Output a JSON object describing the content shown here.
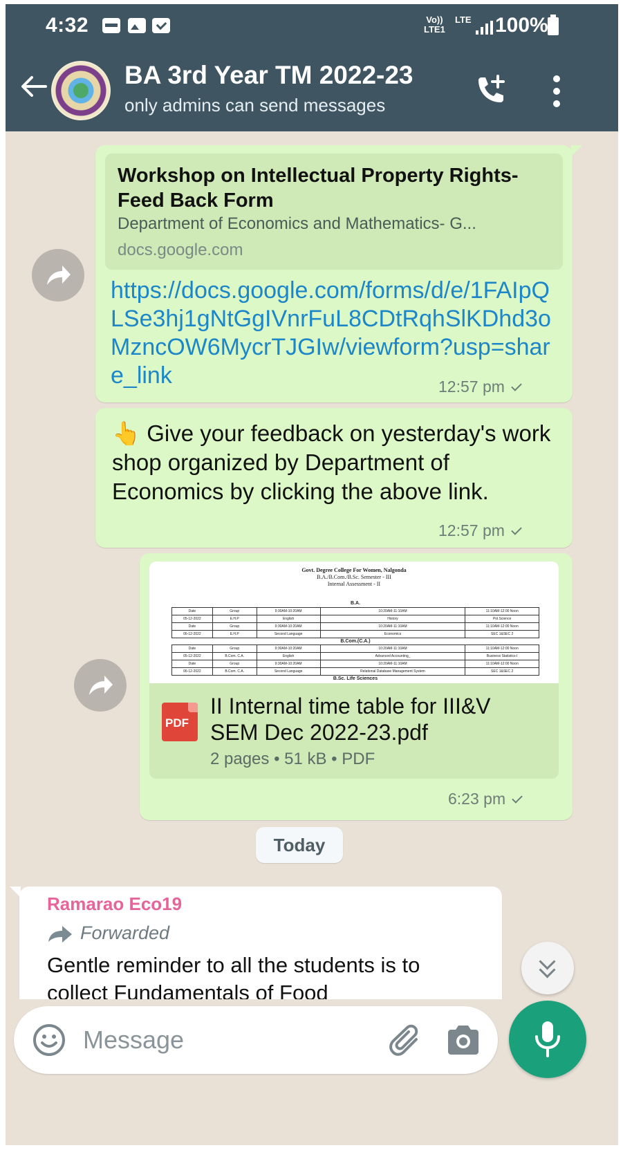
{
  "status_bar": {
    "time": "4:32",
    "network_top": "Vo))",
    "network_bottom": "LTE1",
    "lte": "LTE",
    "battery": "100%"
  },
  "header": {
    "title": "BA 3rd Year TM 2022-23",
    "subtitle": "only admins can send messages",
    "back_icon": "arrow-left-icon",
    "call_icon": "add-call-icon",
    "menu_icon": "more-vert-icon"
  },
  "messages": {
    "link_message": {
      "preview_title": "Workshop on Intellectual Property Rights-Feed Back Form",
      "preview_description": "Department of Economics and Mathematics- G...",
      "preview_domain": "docs.google.com",
      "url": "https://docs.google.com/forms/d/e/1FAIpQLSe3hj1gNtGgIVnrFuL8CDtRqhSlKDhd3oMzncOW6MycrTJGIw/viewform?usp=share_link",
      "time": "12:57 pm"
    },
    "feedback_message": {
      "emoji": "👆",
      "text": "Give your feedback on yesterday's work shop organized by Department of Economics by clicking the above link.",
      "time": "12:57 pm"
    },
    "document_message": {
      "thumb": {
        "line1": "Govt. Degree College For Women, Nalgonda",
        "line2": "B.A./B.Com./B.Sc. Semester - III",
        "line3": "Internal Assessment - II",
        "section_ba": "B.A.",
        "section_bcom": "B.Com.(C.A.)",
        "header_row": [
          "Date",
          "Group",
          "9:30AM-10:20AM",
          "10:20AM-11:10AM",
          "11:10AM-12:00 Noon"
        ],
        "ba_rows": [
          [
            "05-12-2022",
            "E.H.P",
            "English",
            "History",
            "Pol.Science"
          ],
          [
            "06-12-2022",
            "E.H.P",
            "Second Language",
            "Economics",
            "SEC 1&SEC 2"
          ]
        ],
        "bcom_rows": [
          [
            "05-12-2022",
            "B.Com. C.A.",
            "English",
            "Advanced Accounting_",
            "Business Statistics-I"
          ],
          [
            "06-12-2022",
            "B.Com. C.A.",
            "Second Language",
            "Relational Database Management System",
            "SEC 1&SEC 2"
          ]
        ],
        "trailing": "B.Sc. Life Sciences"
      },
      "pdf_label": "PDF",
      "file_name": "II Internal time table for III&V SEM Dec 2022-23.pdf",
      "meta": "2 pages • 51 kB • PDF",
      "time": "6:23 pm"
    },
    "date_separator": "Today",
    "incoming_message": {
      "sender": "Ramarao Eco19",
      "forwarded_label": "Forwarded",
      "text": "Gentle reminder to all the students is to collect Fundamentals of Food"
    }
  },
  "input": {
    "placeholder": "Message",
    "emoji_icon": "emoji-icon",
    "attach_icon": "paperclip-icon",
    "camera_icon": "camera-icon",
    "mic_icon": "mic-icon"
  },
  "colors": {
    "header": "#3f5561",
    "outgoing_bubble": "#dcf8c6",
    "link": "#1c86c8",
    "sender_name": "#e5649a",
    "mic_button": "#1aa17c",
    "pdf_icon": "#e0453a"
  }
}
